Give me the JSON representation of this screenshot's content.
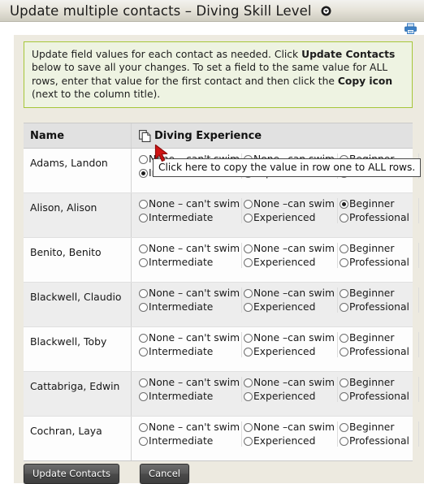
{
  "window": {
    "title": "Update multiple contacts – Diving Skill Level",
    "title_caret_icon": "circle-caret-down-icon",
    "print_icon": "printer-icon"
  },
  "instructions": {
    "part1": "Update field values for each contact as needed. Click ",
    "bold1": "Update Contacts",
    "part2": " below to save all your changes. To set a field to the same value for ALL rows, enter that value for the first contact and then click the ",
    "bold2": "Copy icon",
    "part3": " (next to the column title)."
  },
  "table": {
    "headers": {
      "name": "Name",
      "experience": "Diving Experience",
      "copy_icon": "copy-icon"
    },
    "options": [
      "None – can't swim",
      "None –can swim",
      "Beginner",
      "Intermediate",
      "Experienced",
      "Professional"
    ],
    "rows": [
      {
        "name": "Adams, Landon",
        "selected": "Intermediate"
      },
      {
        "name": "Alison, Alison",
        "selected": "Beginner"
      },
      {
        "name": "Benito, Benito",
        "selected": ""
      },
      {
        "name": "Blackwell, Claudio",
        "selected": ""
      },
      {
        "name": "Blackwell, Toby",
        "selected": ""
      },
      {
        "name": "Cattabriga, Edwin",
        "selected": ""
      },
      {
        "name": "Cochran, Laya",
        "selected": ""
      }
    ]
  },
  "tooltip": {
    "text": "Click here to copy the value in row one to ALL rows."
  },
  "buttons": {
    "update": "Update Contacts",
    "cancel": "Cancel"
  },
  "colors": {
    "callout_border": "#a6c639",
    "callout_bg": "#eef3e2",
    "page_bg": "#edeae0",
    "header_row_bg": "#e1e1e1",
    "cursor_red": "#cc1f1f",
    "printer_blue": "#3c7fc4"
  }
}
